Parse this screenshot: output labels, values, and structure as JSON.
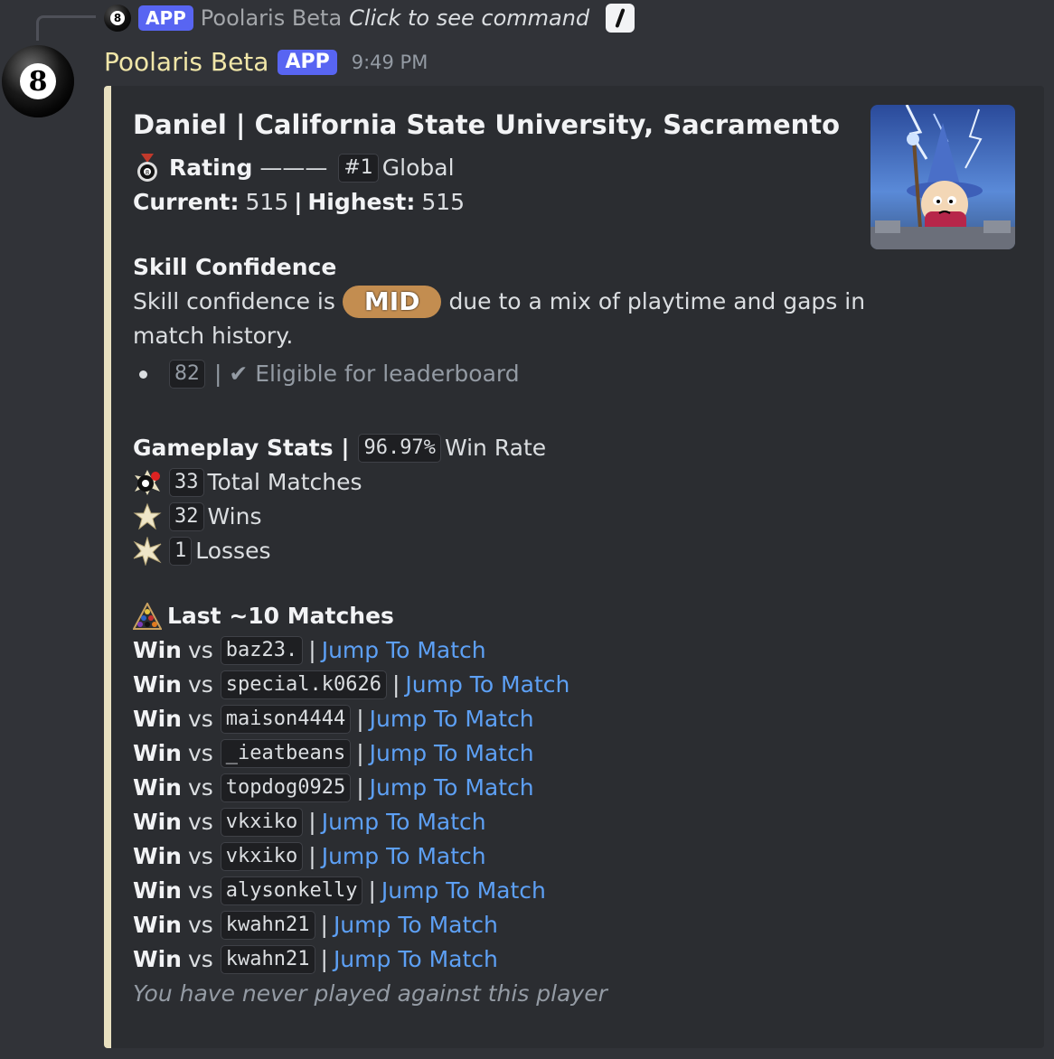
{
  "reply": {
    "app_badge": "APP",
    "bot_name": "Poolaris Beta",
    "command_text": "Click to see command"
  },
  "message": {
    "author": "Poolaris Beta",
    "app_badge": "APP",
    "timestamp": "9:49 PM"
  },
  "embed": {
    "title": "Daniel | California State University, Sacramento",
    "rating": {
      "label": "Rating",
      "dash": "———",
      "rank": "#1",
      "scope": "Global",
      "current_label": "Current:",
      "current_value": "515",
      "sep": "|",
      "highest_label": "Highest:",
      "highest_value": "515"
    },
    "skill": {
      "heading": "Skill Confidence",
      "text_before": "Skill confidence is",
      "level": "MID",
      "text_after": "due to a mix of playtime and gaps in",
      "text_line2": "match history.",
      "count": "82",
      "eligible": "| ✔ Eligible for leaderboard"
    },
    "stats": {
      "heading": "Gameplay Stats |",
      "win_rate": "96.97%",
      "win_rate_label": "Win Rate",
      "total": "33",
      "total_label": "Total Matches",
      "wins": "32",
      "wins_label": "Wins",
      "losses": "1",
      "losses_label": "Losses"
    },
    "matches": {
      "heading": "Last ~10 Matches",
      "items": [
        {
          "result": "Win",
          "vs": "vs",
          "opponent": "baz23.",
          "link": "Jump To Match"
        },
        {
          "result": "Win",
          "vs": "vs",
          "opponent": "special.k0626",
          "link": "Jump To Match"
        },
        {
          "result": "Win",
          "vs": "vs",
          "opponent": "maison4444",
          "link": "Jump To Match"
        },
        {
          "result": "Win",
          "vs": "vs",
          "opponent": "_ieatbeans",
          "link": "Jump To Match"
        },
        {
          "result": "Win",
          "vs": "vs",
          "opponent": "topdog0925",
          "link": "Jump To Match"
        },
        {
          "result": "Win",
          "vs": "vs",
          "opponent": "vkxiko",
          "link": "Jump To Match"
        },
        {
          "result": "Win",
          "vs": "vs",
          "opponent": "vkxiko",
          "link": "Jump To Match"
        },
        {
          "result": "Win",
          "vs": "vs",
          "opponent": "alysonkelly",
          "link": "Jump To Match"
        },
        {
          "result": "Win",
          "vs": "vs",
          "opponent": "kwahn21",
          "link": "Jump To Match"
        },
        {
          "result": "Win",
          "vs": "vs",
          "opponent": "kwahn21",
          "link": "Jump To Match"
        }
      ],
      "footer": "You have never played against this player"
    }
  },
  "colors": {
    "background": "#313338",
    "embed_bg": "#2b2d31",
    "embed_border": "#e8e0c0",
    "link": "#5da0f5",
    "app_badge": "#5865f2",
    "mid_pill": "#c38d50"
  },
  "icons": [
    "8-ball-icon",
    "slash-command-icon",
    "medal-icon",
    "pool-ball-icon",
    "star-icon",
    "burst-star-icon",
    "rack-icon"
  ]
}
